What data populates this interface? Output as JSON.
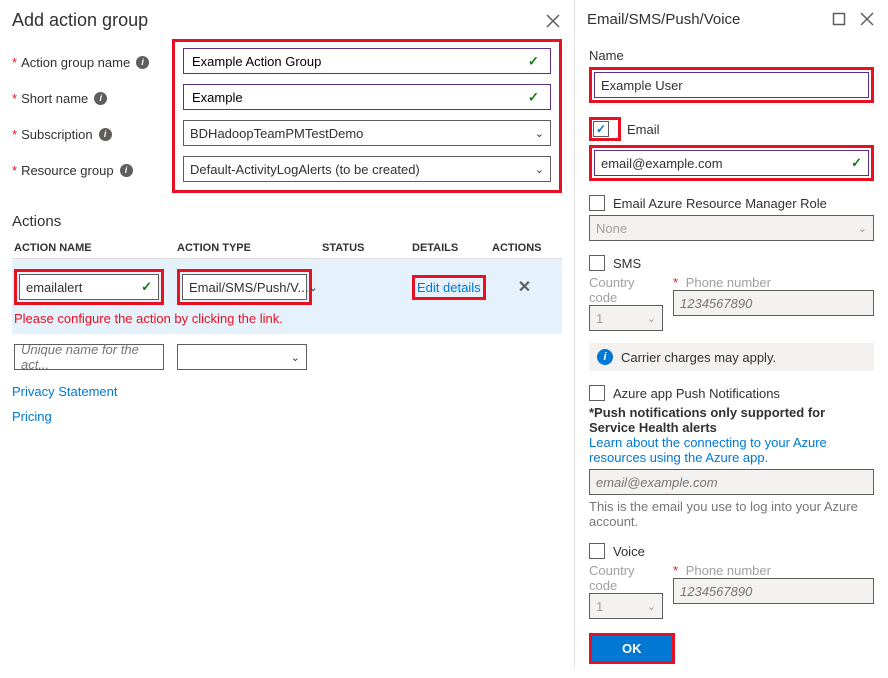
{
  "left": {
    "title": "Add action group",
    "labels": {
      "actionGroupName": "Action group name",
      "shortName": "Short name",
      "subscription": "Subscription",
      "resourceGroup": "Resource group"
    },
    "values": {
      "actionGroupName": "Example Action Group",
      "shortName": "Example",
      "subscription": "BDHadoopTeamPMTestDemo",
      "resourceGroup": "Default-ActivityLogAlerts (to be created)"
    },
    "actionsHeading": "Actions",
    "columns": {
      "name": "Action Name",
      "type": "Action Type",
      "status": "Status",
      "details": "Details",
      "actions": "Actions"
    },
    "row1": {
      "name": "emailalert",
      "type": "Email/SMS/Push/V...",
      "details": "Edit details"
    },
    "errorText": "Please configure the action by clicking the link.",
    "row2Placeholder": "Unique name for the act...",
    "links": {
      "privacy": "Privacy Statement",
      "pricing": "Pricing"
    }
  },
  "right": {
    "title": "Email/SMS/Push/Voice",
    "nameLabel": "Name",
    "nameValue": "Example User",
    "emailLabel": "Email",
    "emailValue": "email@example.com",
    "armRoleLabel": "Email Azure Resource Manager Role",
    "armRoleValue": "None",
    "smsLabel": "SMS",
    "countryCodeLabel": "Country code",
    "phoneLabel": "Phone number",
    "countryCodeValue": "1",
    "phonePlaceholder": "1234567890",
    "carrierNote": "Carrier charges may apply.",
    "pushLabel": "Azure app Push Notifications",
    "pushBold": "*Push notifications only supported for Service Health alerts",
    "pushLink": "Learn about the connecting to your Azure resources using the Azure app.",
    "pushPlaceholder": "email@example.com",
    "pushHelp": "This is the email you use to log into your Azure account.",
    "voiceLabel": "Voice",
    "okLabel": "OK"
  }
}
